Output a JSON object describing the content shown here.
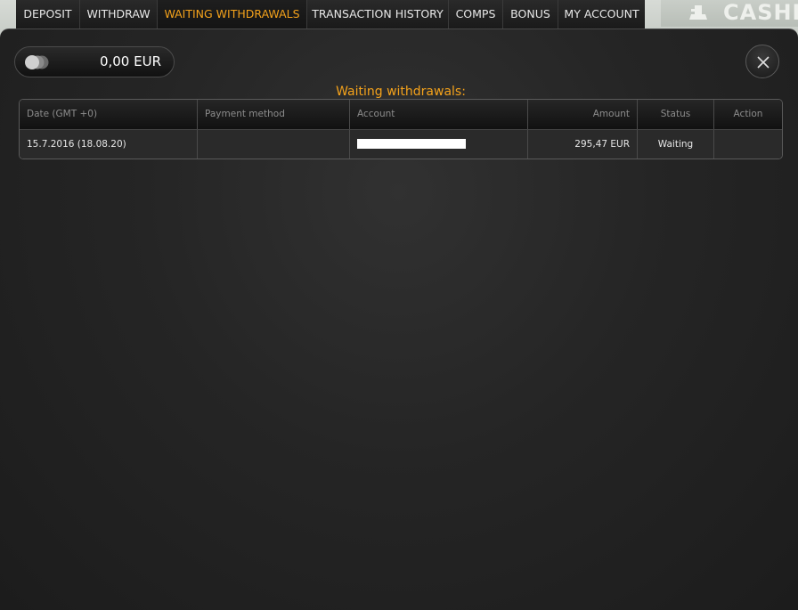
{
  "tabs": [
    {
      "label": "DEPOSIT",
      "active": false
    },
    {
      "label": "WITHDRAW",
      "active": false
    },
    {
      "label": "WAITING WITHDRAWALS",
      "active": true
    },
    {
      "label": "TRANSACTION HISTORY",
      "active": false
    },
    {
      "label": "COMPS",
      "active": false
    },
    {
      "label": "BONUS",
      "active": false
    },
    {
      "label": "MY ACCOUNT",
      "active": false
    }
  ],
  "background": {
    "brand_text": "CASHIE"
  },
  "balance": {
    "value": "0,00 EUR",
    "icon": "coins-icon"
  },
  "close": {
    "icon": "close-icon"
  },
  "section": {
    "title": "Waiting withdrawals:"
  },
  "table": {
    "headers": [
      "Date (GMT +0)",
      "Payment method",
      "Account",
      "Amount",
      "Status",
      "Action"
    ],
    "rows": [
      {
        "date": "15.7.2016 (18.08.20)",
        "payment_method": "",
        "account": "",
        "amount": "295,47 EUR",
        "status": "Waiting",
        "action": ""
      }
    ]
  },
  "colors": {
    "accent": "#f4a21b",
    "panel": "#262626",
    "text": "#e6e6e6",
    "muted": "#8c8c8c"
  }
}
